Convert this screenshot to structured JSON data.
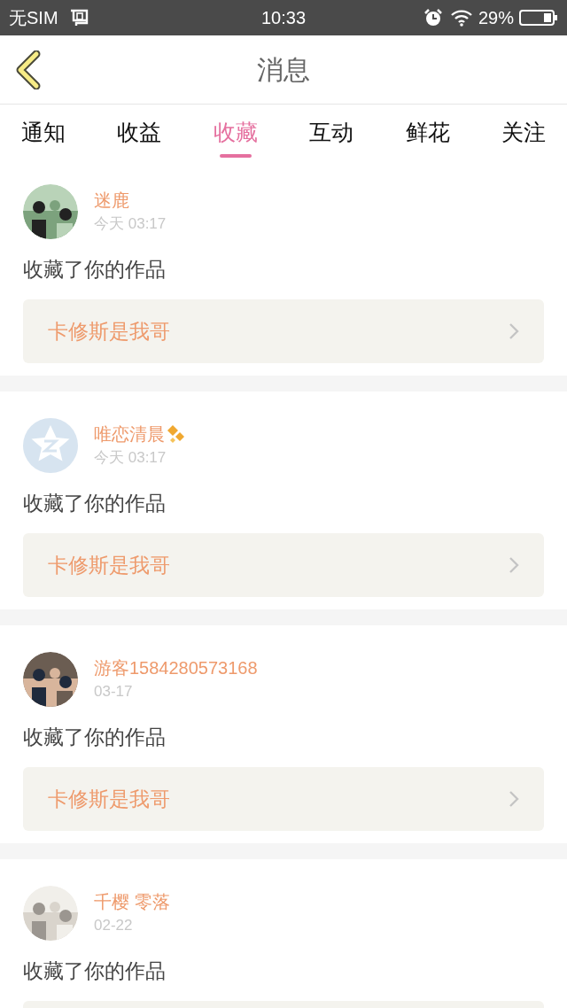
{
  "status_bar": {
    "carrier": "无SIM",
    "time": "10:33",
    "battery": "29%"
  },
  "header": {
    "title": "消息"
  },
  "tabs": [
    {
      "label": "通知",
      "selected": false
    },
    {
      "label": "收益",
      "selected": false
    },
    {
      "label": "收藏",
      "selected": true
    },
    {
      "label": "互动",
      "selected": false
    },
    {
      "label": "鲜花",
      "selected": false
    },
    {
      "label": "关注",
      "selected": false
    }
  ],
  "messages": [
    {
      "kind": "picture",
      "name": "迷鹿",
      "vip": false,
      "time": "今天 03:17",
      "text": "收藏了你的作品",
      "work": "卡修斯是我哥"
    },
    {
      "kind": "default",
      "name": "唯恋清晨",
      "vip": true,
      "time": "今天 03:17",
      "text": "收藏了你的作品",
      "work": "卡修斯是我哥"
    },
    {
      "kind": "picture",
      "name": "游客1584280573168",
      "vip": false,
      "time": "03-17",
      "text": "收藏了你的作品",
      "work": "卡修斯是我哥"
    },
    {
      "kind": "picture",
      "name": "千樱 零落",
      "vip": false,
      "time": "02-22",
      "text": "收藏了你的作品"
    }
  ]
}
